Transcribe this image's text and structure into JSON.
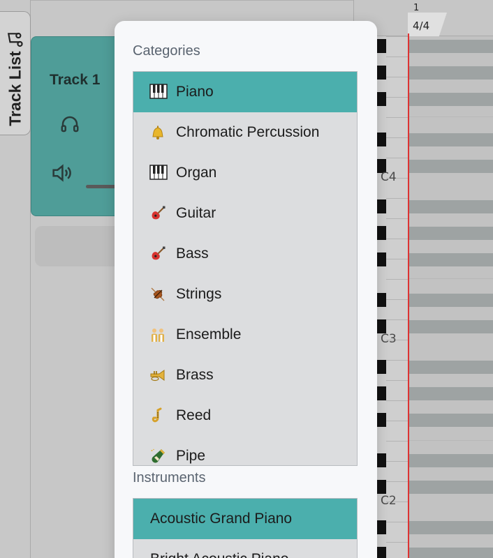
{
  "sidebar": {
    "tab_label": "Track List",
    "tab_icon": "music-note-icon"
  },
  "track": {
    "name": "Track 1",
    "icons": [
      "headphones-icon",
      "speaker-icon"
    ]
  },
  "timeline": {
    "bar_number": "1",
    "time_signature": "4/4"
  },
  "piano_roll": {
    "octave_labels": [
      "C4",
      "C3",
      "C2"
    ],
    "playhead_color": "#d33333"
  },
  "picker": {
    "categories_title": "Categories",
    "instruments_title": "Instruments",
    "accent_color": "#4bafad",
    "categories": [
      {
        "label": "Piano",
        "icon": "piano-keys-icon",
        "selected": true
      },
      {
        "label": "Chromatic Percussion",
        "icon": "bell-icon",
        "selected": false
      },
      {
        "label": "Organ",
        "icon": "piano-keys-icon",
        "selected": false
      },
      {
        "label": "Guitar",
        "icon": "guitar-icon",
        "selected": false
      },
      {
        "label": "Bass",
        "icon": "guitar-icon",
        "selected": false
      },
      {
        "label": "Strings",
        "icon": "violin-icon",
        "selected": false
      },
      {
        "label": "Ensemble",
        "icon": "people-icon",
        "selected": false
      },
      {
        "label": "Brass",
        "icon": "trumpet-icon",
        "selected": false
      },
      {
        "label": "Reed",
        "icon": "saxophone-icon",
        "selected": false
      },
      {
        "label": "Pipe",
        "icon": "bottle-icon",
        "selected": false
      }
    ],
    "instruments": [
      {
        "label": "Acoustic Grand Piano",
        "selected": true
      },
      {
        "label": "Bright Acoustic Piano",
        "selected": false
      }
    ]
  }
}
